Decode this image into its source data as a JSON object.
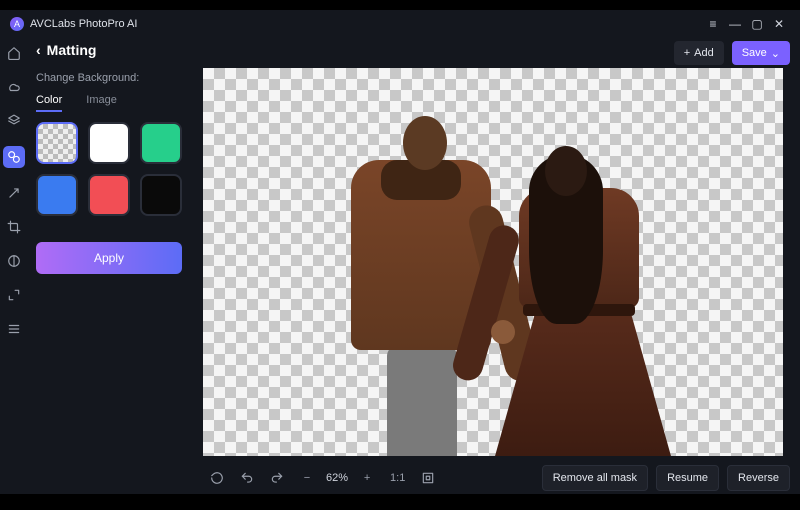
{
  "app": {
    "title": "AVCLabs PhotoPro AI"
  },
  "topbar": {
    "add_label": "Add",
    "save_label": "Save"
  },
  "panel": {
    "title": "Matting",
    "section_label": "Change Background:",
    "tabs": {
      "color": "Color",
      "image": "Image"
    },
    "apply_label": "Apply"
  },
  "swatches": [
    {
      "name": "transparent",
      "selected": true
    },
    {
      "name": "white"
    },
    {
      "name": "green"
    },
    {
      "name": "blue"
    },
    {
      "name": "red"
    },
    {
      "name": "black"
    }
  ],
  "toolbar": {
    "zoom_value": "62%",
    "ratio_label": "1:1",
    "remove_mask_label": "Remove all mask",
    "resume_label": "Resume",
    "reverse_label": "Reverse"
  },
  "rail_tools": [
    "home",
    "back",
    "retouch",
    "object",
    "magic",
    "crop",
    "adjust",
    "scale",
    "settings"
  ]
}
